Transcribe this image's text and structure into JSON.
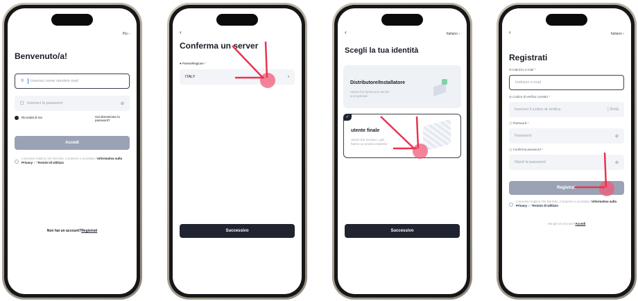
{
  "screen1": {
    "more_label": "Più",
    "title": "Benvenuto/a!",
    "username_placeholder": "Inserisci nome utente/e-mail",
    "password_placeholder": "Inserisci la password",
    "remember_label": "Ricordati di me",
    "forgot_label": "Hai dimenticato la password?",
    "login_button": "Accedi",
    "terms_text": "L'accesso implica che hai letto, compreso e accettato l'",
    "terms_link1": "Informativa sulla Privacy",
    "terms_and": " e l'",
    "terms_link2": "Termini di Utilizzo",
    "no_account": "Non hai un account?",
    "register_link": "Registrati"
  },
  "screen2": {
    "title": "Conferma un server",
    "region_label": "Paese/Regione",
    "country": "ITALY",
    "next_button": "Successivo"
  },
  "screen3": {
    "language": "Italiano",
    "title": "Scegli la tua identità",
    "installer_title": "Distributore/Installatore",
    "installer_desc": "Utenti che forniscono servizi ai proprietari",
    "enduser_title": "utente finale",
    "enduser_desc": "Utenti che avviano o già hanno un proprio impianto",
    "next_button": "Successivo"
  },
  "screen4": {
    "language": "Italiano",
    "title": "Registrati",
    "email_label": "Indirizzo e-mail",
    "email_placeholder": "Indirizzo e-mail",
    "code_label": "Codice di verifica corretto",
    "code_placeholder": "Inserisci il codice di verifica",
    "send_label": "Invia",
    "password_label": "Password",
    "password_placeholder": "Password",
    "confirm_label": "Conferma password",
    "confirm_placeholder": "Ripeti la password",
    "register_button": "Registrati",
    "terms_text": "L'accesso implica che hai letto, compreso e accettato l'",
    "terms_link1": "Informativa sulla Privacy",
    "terms_and": " e l'",
    "terms_link2": "Termini di Utilizzo",
    "have_account": "Hai già un account?",
    "login_link": "Accedi"
  },
  "colors": {
    "dark": "#1f2430",
    "disabled": "#9aa3b5",
    "highlight": "#f05a78",
    "arrow": "#e8334f"
  }
}
